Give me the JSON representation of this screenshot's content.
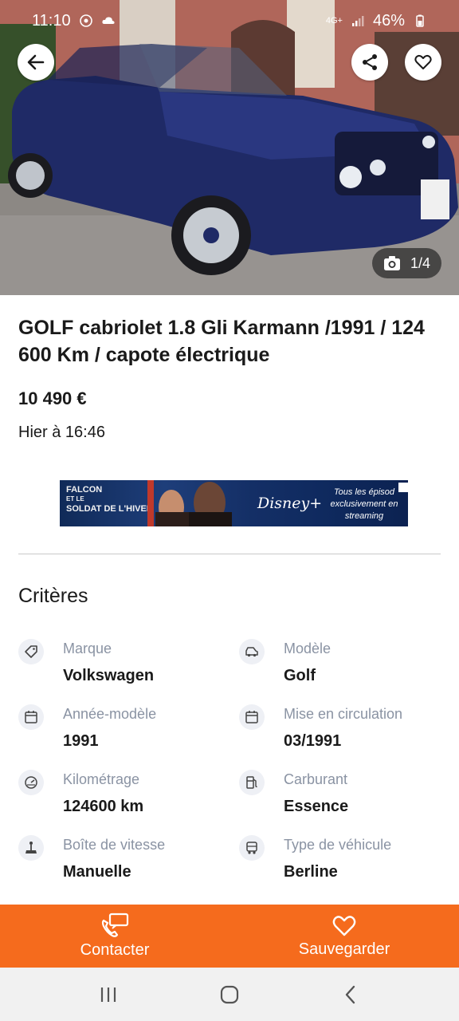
{
  "status_bar": {
    "time": "11:10",
    "network": "4G+",
    "battery": "46%"
  },
  "photo": {
    "counter": "1/4"
  },
  "listing": {
    "title": "GOLF cabriolet 1.8 Gli Karmann /1991 / 124 600 Km / capote électrique",
    "price": "10 490 €",
    "date": "Hier à 16:46"
  },
  "ad": {
    "left_line1": "FALCON",
    "left_line2": "ET LE",
    "left_line3": "SOLDAT DE L'HIVER",
    "brand": "Disney+",
    "right_text": "Tous les épisod exclusivement en streaming"
  },
  "criteria": {
    "title": "Critères",
    "items": [
      {
        "label": "Marque",
        "value": "Volkswagen",
        "icon": "tag-icon"
      },
      {
        "label": "Modèle",
        "value": "Golf",
        "icon": "car-icon"
      },
      {
        "label": "Année-modèle",
        "value": "1991",
        "icon": "calendar-icon"
      },
      {
        "label": "Mise en circulation",
        "value": "03/1991",
        "icon": "calendar-icon"
      },
      {
        "label": "Kilométrage",
        "value": "124600 km",
        "icon": "gauge-icon"
      },
      {
        "label": "Carburant",
        "value": "Essence",
        "icon": "fuel-icon"
      },
      {
        "label": "Boîte de vitesse",
        "value": "Manuelle",
        "icon": "gearbox-icon"
      },
      {
        "label": "Type de véhicule",
        "value": "Berline",
        "icon": "vehicle-type-icon"
      }
    ]
  },
  "actions": {
    "contact": "Contacter",
    "save": "Sauvegarder"
  },
  "colors": {
    "accent": "#f56b1d",
    "label": "#8a93a3"
  }
}
